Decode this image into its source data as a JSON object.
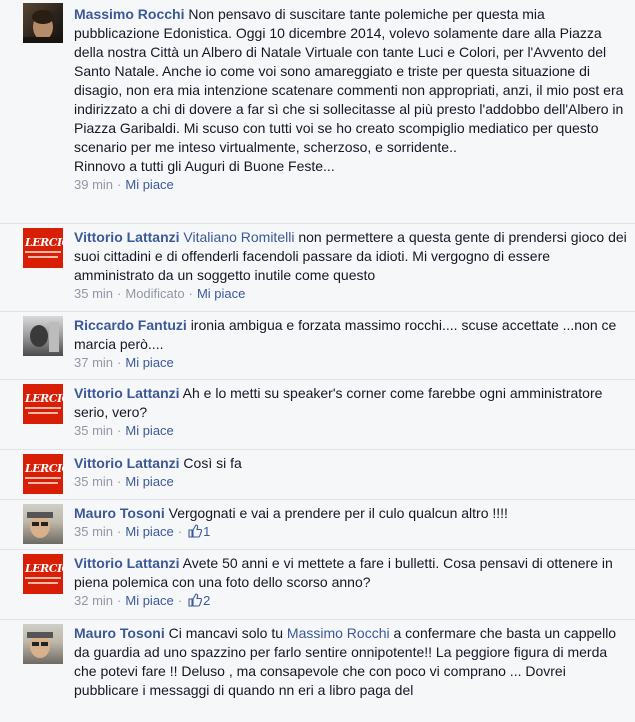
{
  "comments": [
    {
      "author": "Massimo Rocchi",
      "mention": "",
      "text": "Non pensavo di suscitare tante polemiche per questa mia pubblicazione Edonistica. Oggi 10 dicembre 2014, volevo solamente dare alla Piazza della nostra Città un Albero di Natale Virtuale con tante Luci e Colori, per l'Avvento del Santo Natale. Anche io come voi sono amareggiato e triste per questa situazione di disagio, non era mia intenzione scatenare commenti non appropriati, anzi, il mio post era indirizzato a chi di dovere a far sì che si sollecitasse al più presto l'addobbo dell'Albero in Piazza Garibaldi. Mi scuso con tutti voi se ho creato scompiglio mediatico per questo scenario per me inteso virtualmente, scherzoso, e sorridente..",
      "text2": "Rinnovo a tutti gli Auguri di Buone Feste...",
      "time": "39 min",
      "edited": "",
      "like_label": "Mi piace",
      "likes": ""
    },
    {
      "author": "Vittorio Lattanzi",
      "mention": "Vitaliano Romitelli",
      "text": "non permettere a questa gente di prendersi gioco dei suoi cittadini e di offenderli facendoli passare da idioti. Mi vergogno di essere amministrato da un soggetto inutile come questo",
      "time": "35 min",
      "edited": "Modificato",
      "like_label": "Mi piace",
      "likes": ""
    },
    {
      "author": "Riccardo Fantuzi",
      "mention": "",
      "text": "ironia ambigua e forzata massimo rocchi.... scuse accettate ...non ce marcia però....",
      "time": "37 min",
      "edited": "",
      "like_label": "Mi piace",
      "likes": ""
    },
    {
      "author": "Vittorio Lattanzi",
      "mention": "",
      "text": "Ah e lo metti su speaker's corner come farebbe ogni amministratore serio, vero?",
      "time": "35 min",
      "edited": "",
      "like_label": "Mi piace",
      "likes": ""
    },
    {
      "author": "Vittorio Lattanzi",
      "mention": "",
      "text": "Così si fa",
      "time": "35 min",
      "edited": "",
      "like_label": "Mi piace",
      "likes": ""
    },
    {
      "author": "Mauro Tosoni",
      "mention": "",
      "text": "Vergognati e vai a prendere per il culo qualcun altro !!!!",
      "time": "35 min",
      "edited": "",
      "like_label": "Mi piace",
      "likes": "1"
    },
    {
      "author": "Vittorio Lattanzi",
      "mention": "",
      "text": "Avete 50 anni e vi mettete a fare i bulletti. Cosa pensavi di ottenere in piena polemica con una foto dello scorso anno?",
      "time": "32 min",
      "edited": "",
      "like_label": "Mi piace",
      "likes": "2"
    },
    {
      "author": "Mauro Tosoni",
      "mention": "Massimo Rocchi",
      "text_before": "Ci mancavi solo tu",
      "text": "a confermare che basta un cappello da guardia ad uno spazzino per farlo sentire onnipotente!! La peggiore figura di merda che potevi fare !! Deluso , ma consapevole che con poco vi comprano ... Dovrei pubblicare i messaggi di quando nn eri a libro paga del",
      "time": "",
      "edited": "",
      "like_label": "",
      "likes": ""
    }
  ],
  "avatar_logo_text": "LERCIO",
  "colors": {
    "link": "#3b5998",
    "meta": "#9197a3",
    "lercio": "#d81e05"
  }
}
